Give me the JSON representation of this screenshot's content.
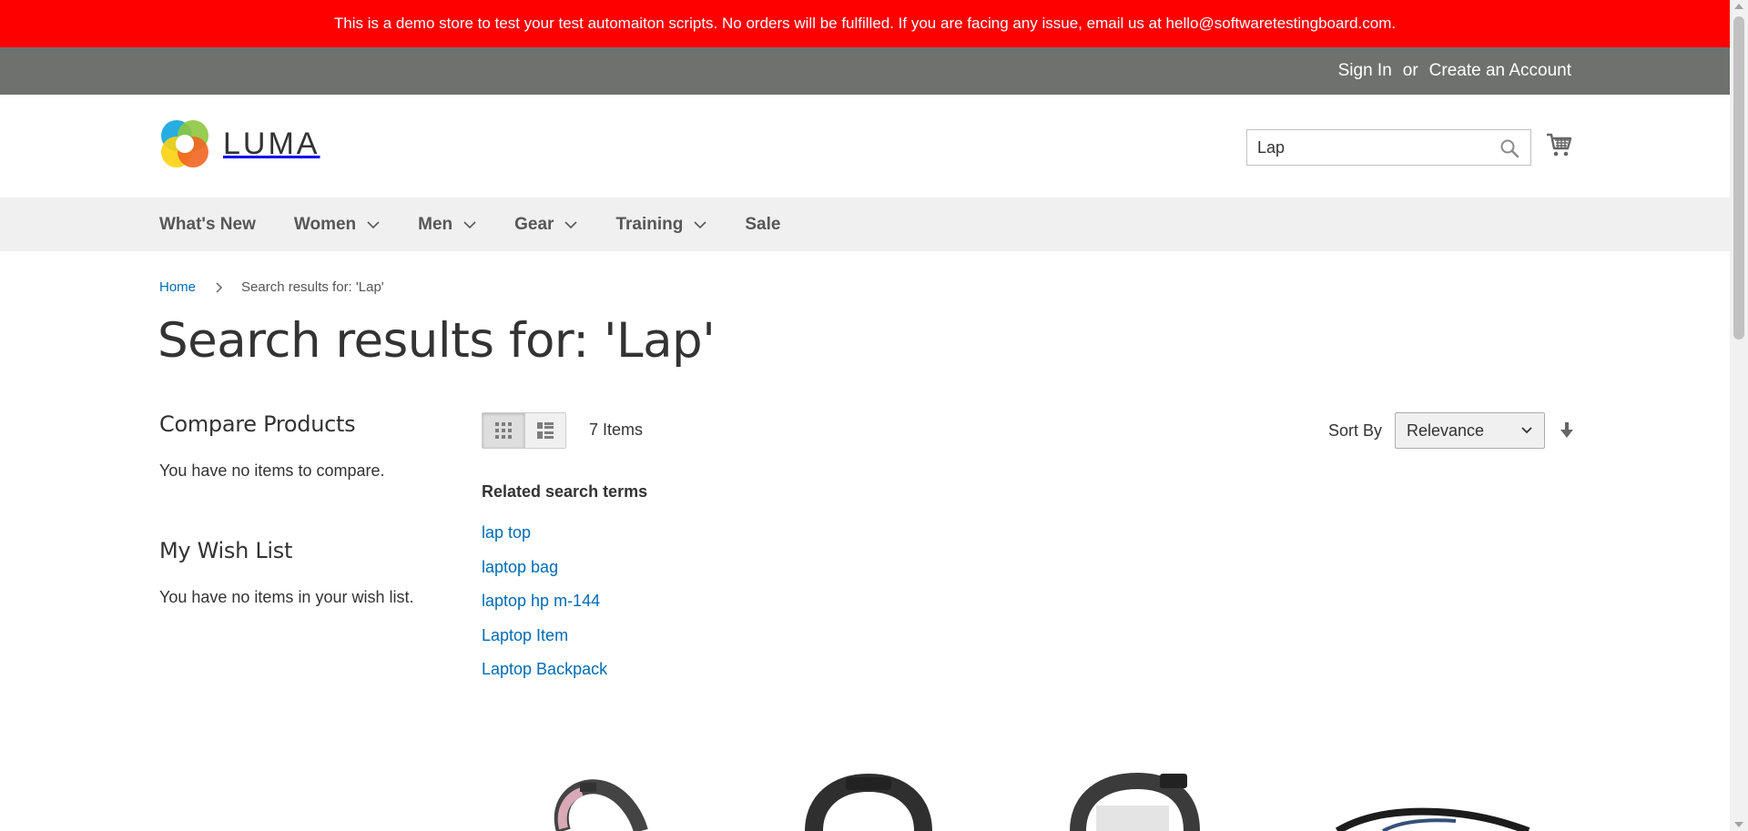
{
  "demo_notice": "This is a demo store to test your test automaiton scripts. No orders will be fulfilled. If you are facing any issue, email us at hello@softwaretestingboard.com.",
  "header_links": {
    "sign_in": "Sign In",
    "or": "or",
    "create_account": "Create an Account"
  },
  "logo": {
    "text": "LUMA"
  },
  "search": {
    "value": "Lap",
    "icon": "search-icon"
  },
  "cart": {
    "icon": "cart-icon"
  },
  "nav": {
    "items": [
      {
        "label": "What's New",
        "has_dropdown": false
      },
      {
        "label": "Women",
        "has_dropdown": true
      },
      {
        "label": "Men",
        "has_dropdown": true
      },
      {
        "label": "Gear",
        "has_dropdown": true
      },
      {
        "label": "Training",
        "has_dropdown": true
      },
      {
        "label": "Sale",
        "has_dropdown": false
      }
    ]
  },
  "breadcrumb": {
    "home": "Home",
    "current": "Search results for: 'Lap'"
  },
  "page_title": "Search results for: 'Lap'",
  "sidebar": {
    "compare_title": "Compare Products",
    "compare_empty": "You have no items to compare.",
    "wishlist_title": "My Wish List",
    "wishlist_empty": "You have no items in your wish list."
  },
  "toolbar": {
    "count": "7 Items",
    "sort_label": "Sort By",
    "sort_value": "Relevance",
    "view_mode": "grid"
  },
  "related": {
    "title": "Related search terms",
    "terms": [
      "lap top",
      "laptop bag",
      "laptop hp m-144",
      "Laptop Item",
      "Laptop Backpack"
    ]
  },
  "colors": {
    "demo_bar": "#ff0000",
    "top_bar": "#6e716e",
    "link": "#006bb4",
    "nav_bg": "#f0f0f0"
  }
}
